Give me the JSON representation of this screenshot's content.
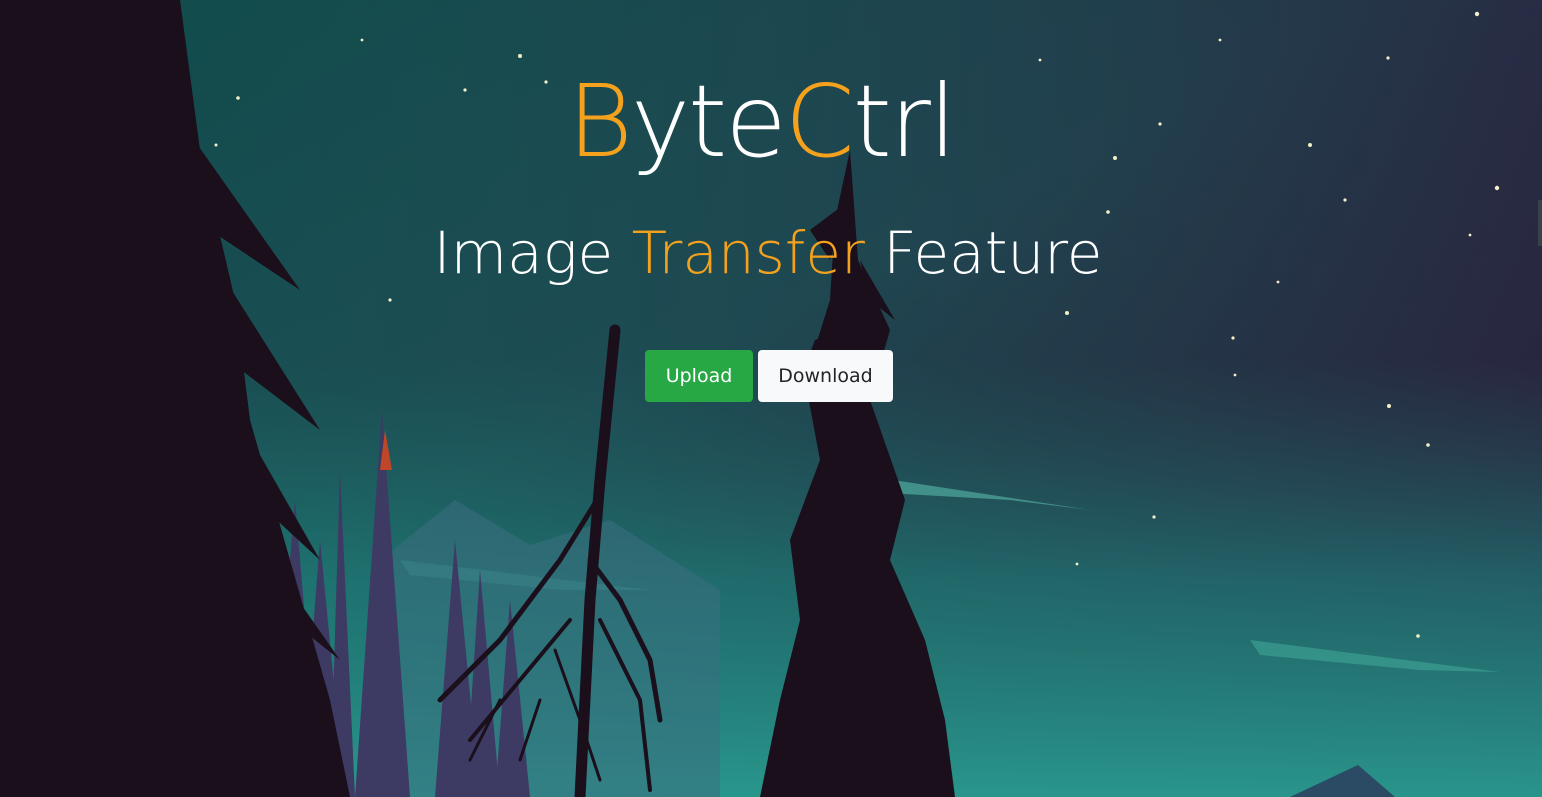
{
  "brand": {
    "part1_accent": "B",
    "part2": "yte",
    "part3_accent": "C",
    "part4": "trl"
  },
  "subtitle": {
    "word1": "Image",
    "word2_accent": "Transfer",
    "word3": "Feature"
  },
  "buttons": {
    "upload_label": "Upload",
    "download_label": "Download"
  },
  "colors": {
    "accent": "#f4a11d",
    "upload_bg": "#28a745",
    "download_bg": "#f8f9fa"
  },
  "background": {
    "icon": "night-forest-illustration"
  }
}
